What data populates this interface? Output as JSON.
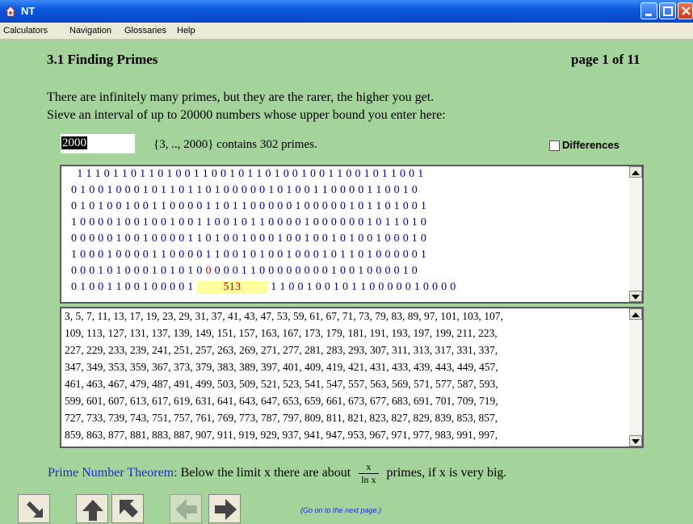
{
  "window": {
    "title": "NT"
  },
  "menu": [
    "Calculators",
    "Navigation",
    "Glossaries",
    "Help"
  ],
  "section": {
    "title": "3.1 Finding Primes",
    "page": "page 1 of 11"
  },
  "intro": {
    "line1": "There are infinitely many primes, but they are the rarer, the higher you get.",
    "line2": "Sieve an interval of up to 20000 numbers whose upper bound you enter here:"
  },
  "input": {
    "value": "2000"
  },
  "result": "{3, .., 2000} contains 302 primes.",
  "differences": {
    "label": "Differences",
    "checked": false
  },
  "bits": {
    "rows": [
      "   1 1 1 0 1 1 0 1 1 0 1 0 0 1 1 0 0 1 0 1 1 0 1 0 0 1 0 0 1 1 0 0 1 0 1 1 0 0 1",
      "0 1 0 0 1 0 0 0 1 0 1 1 0 1 1 0 1 0 0 0 0 0 1 0 1 0 0 1 1 0 0 0 0 1 1 0 0 1 0",
      "0 1 0 1 0 0 1 0 0 1 1 0 0 0 0 1 1 0 1 1 0 0 0 0 0 1 0 0 0 0 0 1 0 1 1 0 1 0 0 1",
      "1 0 0 0 0 1 0 0 1 0 0 1 0 0 1 1 0 0 1 0 1 1 0 0 0 0 1 0 0 0 0 0 0 1 0 1 1 0 1 0",
      "0 0 0 0 0 1 0 0 1 0 0 0 0 1 1 0 1 0 0 1 0 0 0 1 0 0 1 0 0 1 0 1 0 0 1 0 0 0 1 0",
      "1 0 0 0 1 0 0 0 0 1 1 0 0 0 0 1 1 0 0 1 0 1 0 0 1 0 0 0 1 0 1 1 0 1 0 0 0 0 0 1",
      "0 0 0 1 0 1 0 0 0 1 0 1 0 1 0 ",
      "0 1 0 0 1 1 0 0 1 0 0 0 0 1 "
    ],
    "row7_red": "0",
    "row7_tail": " 0 0 0 1 1 0 0 0 0 0 0 0 0 1 0 0 1 0 0 0 0 1 0",
    "highlight": "513",
    "row8_tail": "1 1 0 0 1 0 0 1 0 1 1 0 0 0 0 0 1 0 0 0 0"
  },
  "primes": [
    "3, 5, 7, 11, 13, 17, 19, 23, 29, 31, 37, 41, 43, 47, 53, 59, 61, 67, 71, 73, 79, 83, 89, 97, 101, 103, 107,",
    "109, 113, 127, 131, 137, 139, 149, 151, 157, 163, 167, 173, 179, 181, 191, 193, 197, 199, 211, 223,",
    "227, 229, 233, 239, 241, 251, 257, 263, 269, 271, 277, 281, 283, 293, 307, 311, 313, 317, 331, 337,",
    "347, 349, 353, 359, 367, 373, 379, 383, 389, 397, 401, 409, 419, 421, 431, 433, 439, 443, 449, 457,",
    "461, 463, 467, 479, 487, 491, 499, 503, 509, 521, 523, 541, 547, 557, 563, 569, 571, 577, 587, 593,",
    "599, 601, 607, 613, 617, 619, 631, 641, 643, 647, 653, 659, 661, 673, 677, 683, 691, 701, 709, 719,",
    "727, 733, 739, 743, 751, 757, 761, 769, 773, 787, 797, 809, 811, 821, 823, 827, 829, 839, 853, 857,",
    "859, 863, 877, 881, 883, 887, 907, 911, 919, 929, 937, 941, 947, 953, 967, 971, 977, 983, 991, 997,"
  ],
  "theorem": {
    "label": "Prime Number Theorem:",
    "text_before": "Below the limit x there are about",
    "num": "x",
    "den": "ln x",
    "text_after": "primes, if x is very big."
  },
  "hint": "(Go on to the next page.)",
  "colors": {
    "accent_blue": "#1a2bd8",
    "background": "#a4d49c",
    "bits_blue": "#00008b",
    "highlight": "#ffff9e"
  }
}
